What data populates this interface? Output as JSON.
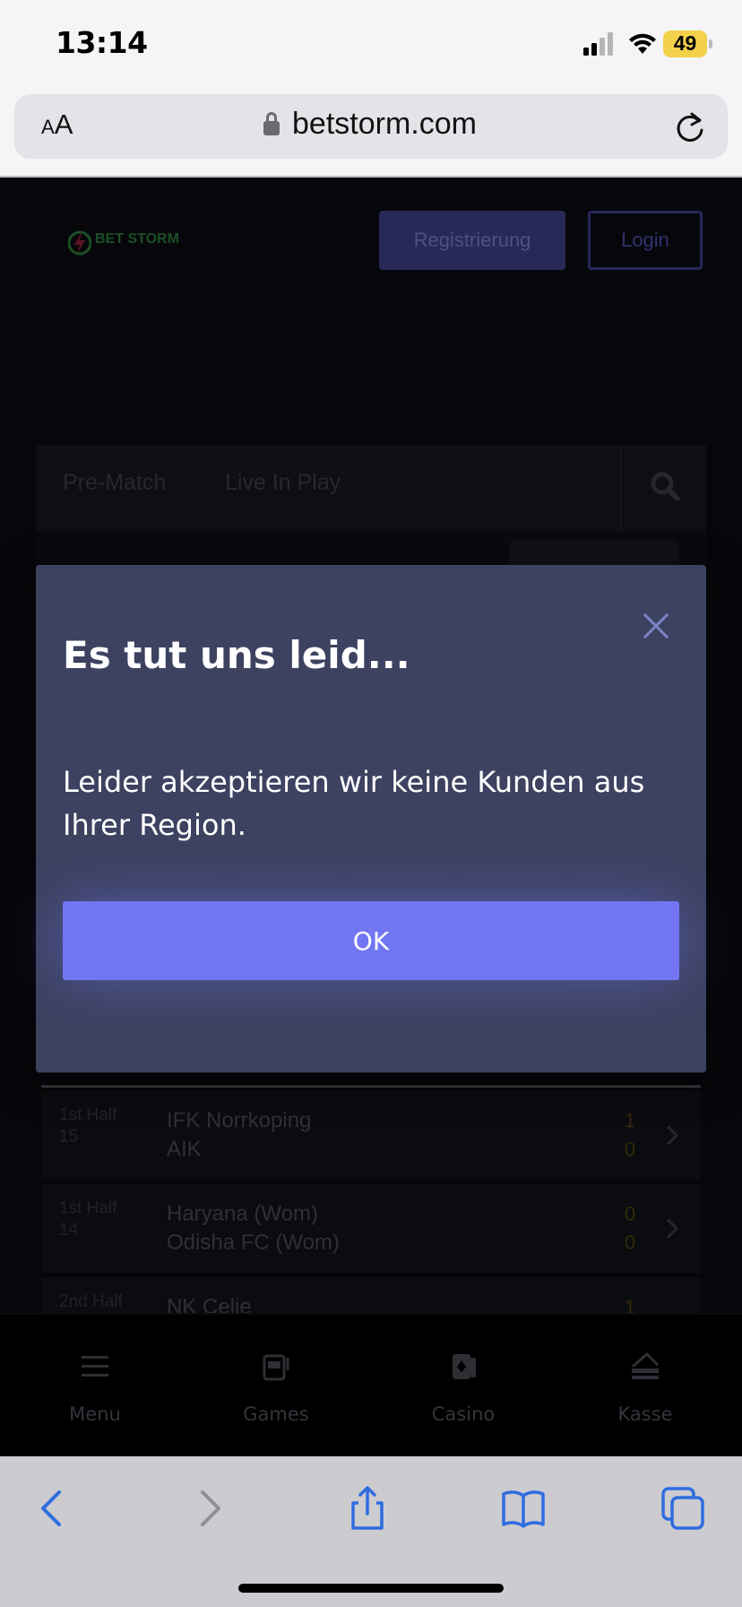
{
  "status_bar": {
    "time": "13:14",
    "battery": "49"
  },
  "browser": {
    "text_size_label_small": "A",
    "text_size_label_large": "A",
    "domain": "betstorm.com"
  },
  "header": {
    "logo_text": "BET STORM",
    "register_label": "Registrierung",
    "login_label": "Login"
  },
  "tabs": [
    {
      "label": "Pre-Match"
    },
    {
      "label": "Live In Play"
    }
  ],
  "matches": [
    {
      "period": "1st Half",
      "minute": "15",
      "team1": "IFK Norrkoping",
      "team2": "AIK",
      "score1": "1",
      "score2": "0"
    },
    {
      "period": "1st Half",
      "minute": "14",
      "team1": "Haryana (Wom)",
      "team2": "Odisha FC (Wom)",
      "score1": "0",
      "score2": "0"
    },
    {
      "period": "2nd Half",
      "minute": "",
      "team1": "NK Celje",
      "team2": "",
      "score1": "1",
      "score2": ""
    }
  ],
  "modal": {
    "title": "Es tut uns leid...",
    "message": "Leider akzeptieren wir keine Kunden aus Ihrer Region.",
    "ok_label": "OK"
  },
  "app_nav": [
    {
      "label": "Menu",
      "icon": "menu-icon"
    },
    {
      "label": "Games",
      "icon": "slot-machine-icon"
    },
    {
      "label": "Casino",
      "icon": "cards-icon"
    },
    {
      "label": "Kasse",
      "icon": "cashier-icon"
    }
  ],
  "colors": {
    "accent": "#7276f2",
    "modal_bg": "#3c4260",
    "page_bg": "#0c0c12"
  }
}
